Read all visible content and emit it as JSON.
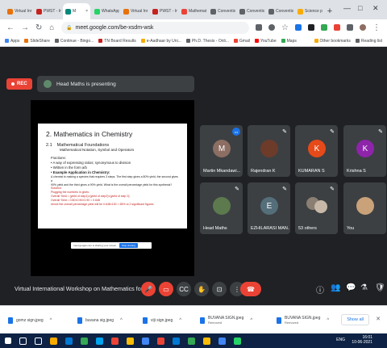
{
  "browser": {
    "tabs": [
      {
        "label": "Virtual Inr",
        "color": "#e8710a"
      },
      {
        "label": "PWST - In",
        "color": "#c5221f"
      },
      {
        "label": "M",
        "color": "#00897b",
        "active": true
      },
      {
        "label": "WhatsApp",
        "color": "#25d366"
      },
      {
        "label": "Virtual Inr",
        "color": "#e8710a"
      },
      {
        "label": "PWST - In",
        "color": "#c5221f"
      },
      {
        "label": "Mathemat",
        "color": "#ea4335"
      },
      {
        "label": "Conventio",
        "color": "#5f6368"
      },
      {
        "label": "Conventio",
        "color": "#5f6368"
      },
      {
        "label": "Conventio",
        "color": "#5f6368"
      },
      {
        "label": "Science pr",
        "color": "#f9ab00"
      }
    ],
    "new_tab": "+",
    "address": "meet.google.com/be-xsdm-wsk",
    "bookmarks": [
      {
        "label": "Apps",
        "color": "#4285f4"
      },
      {
        "label": "SlideShare",
        "color": "#e8710a"
      },
      {
        "label": "Continue - Bingo...",
        "color": "#5f6368"
      },
      {
        "label": "TN Board Results",
        "color": "#c5221f"
      },
      {
        "label": "e-Aadhaar by Uni...",
        "color": "#f9ab00"
      },
      {
        "label": "Ph.D. Thesis - Onli...",
        "color": "#5f6368"
      },
      {
        "label": "Gmail",
        "color": "#ea4335"
      },
      {
        "label": "YouTube",
        "color": "#ff0000"
      },
      {
        "label": "Maps",
        "color": "#34a853"
      },
      {
        "label": "Other bookmarks",
        "color": "#f9ab00"
      },
      {
        "label": "Reading list",
        "color": "#5f6368"
      }
    ]
  },
  "meet": {
    "rec_label": "REC",
    "presenting_text": "Head Maths is presenting",
    "slide": {
      "title": "2. Mathematics in Chemistry",
      "section_num": "2.1",
      "section_title": "Mathematical Foundations",
      "subtitle": "Mathematical Notation, Symbol and Operators",
      "lines": [
        "Fractions:",
        "• A way of expressing ratios; synonymous to division",
        "• Written in the form a/b",
        "• Example Application in Chemistry:",
        "A chemist is making a species that requires 3 steps. The first step gives a 80% yield, the second gives a",
        "90% yield and the third gives a 90% yield. What is the overall percentage yield for this synthesis?",
        "Solution:",
        "Plugging the numbers in gives:",
        "Overall Yield = (yield of step1)×(yield of step2)×(yield of step 3)",
        "Overall Yield = 0.80×0.90×0.90 = 0.648",
        "hence the overall percentage yield will be 0.648×100 = 65% to 2 significant figures"
      ],
      "stop_share_text": "meet.google.com is sharing your screen.",
      "stop_share_btn": "Stop sharing"
    },
    "participants": [
      {
        "name": "Martin Mkandawi...",
        "initial": "M",
        "bg": "#8d6e63",
        "kind": "initial"
      },
      {
        "name": "Rajendran K",
        "initial": "",
        "bg": "",
        "kind": "image"
      },
      {
        "name": "KUMARAN S",
        "initial": "K",
        "bg": "#e64a19",
        "kind": "initial"
      },
      {
        "name": "Krishna S",
        "initial": "K",
        "bg": "#8e24aa",
        "kind": "initial"
      },
      {
        "name": "Head Maths",
        "initial": "",
        "bg": "",
        "kind": "image"
      },
      {
        "name": "EZHILARASI MAN...",
        "initial": "E",
        "bg": "#546e7a",
        "kind": "initial"
      },
      {
        "name": "53 others",
        "initial": "",
        "bg": "",
        "kind": "others"
      },
      {
        "name": "You",
        "initial": "",
        "bg": "",
        "kind": "image"
      }
    ],
    "meeting_title": "Virtual International Workshop on Mathematics for C..."
  },
  "downloads": [
    {
      "name": "gomz sign.jpeg",
      "status": ""
    },
    {
      "name": "buvana sig.jpeg",
      "status": ""
    },
    {
      "name": "viji sign.jpeg",
      "status": ""
    },
    {
      "name": "BUVANA SIGN.jpeg",
      "status": "Removed"
    },
    {
      "name": "BUVANA SIGN.jpeg",
      "status": "Removed"
    }
  ],
  "show_all": "Show all",
  "taskbar": {
    "time": "16:01",
    "date": "10-06-2021",
    "lang": "ENG",
    "apps": [
      "#ffffff",
      "#ffffff",
      "#ffffff",
      "#f9ab00",
      "#0078d4",
      "#34a853",
      "#00a4ef",
      "#ea4335",
      "#fbbc05",
      "#4285f4",
      "#ea4335",
      "#0078d4",
      "#34a853",
      "#fbbc05",
      "#4285f4",
      "#25d366"
    ]
  }
}
